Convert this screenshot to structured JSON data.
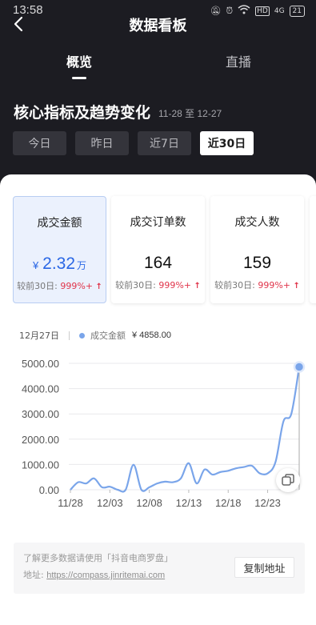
{
  "status_bar": {
    "time": "13:58",
    "icons": [
      "bell-off-icon",
      "alarm-icon",
      "wifi-icon",
      "hd-icon",
      "signal-icon",
      "battery-icon"
    ],
    "network": "4G",
    "battery": "21"
  },
  "nav": {
    "title": "数据看板"
  },
  "tabs": [
    {
      "label": "概览",
      "active": true
    },
    {
      "label": "直播",
      "active": false
    }
  ],
  "section": {
    "title": "核心指标及趋势变化",
    "range": "11-28 至 12-27"
  },
  "periods": [
    {
      "label": "今日",
      "active": false
    },
    {
      "label": "昨日",
      "active": false
    },
    {
      "label": "近7日",
      "active": false
    },
    {
      "label": "近30日",
      "active": true
    }
  ],
  "metrics": [
    {
      "label": "成交金额",
      "currency": "¥",
      "value": "2.32",
      "unit": "万",
      "compare_prefix": "较前30日: ",
      "compare_value": "999%+",
      "active": true
    },
    {
      "label": "成交订单数",
      "currency": "",
      "value": "164",
      "unit": "",
      "compare_prefix": "较前30日: ",
      "compare_value": "999%+",
      "active": false
    },
    {
      "label": "成交人数",
      "currency": "",
      "value": "159",
      "unit": "",
      "compare_prefix": "较前30日: ",
      "compare_value": "999%+",
      "active": false
    }
  ],
  "legend": {
    "date": "12月27日",
    "series_name": "成交金额",
    "series_value": "¥ 4858.00"
  },
  "chart_data": {
    "type": "line",
    "series": [
      {
        "name": "成交金额",
        "x": [
          "11/28",
          "11/29",
          "11/30",
          "12/01",
          "12/02",
          "12/03",
          "12/04",
          "12/05",
          "12/06",
          "12/07",
          "12/08",
          "12/09",
          "12/10",
          "12/11",
          "12/12",
          "12/13",
          "12/14",
          "12/15",
          "12/16",
          "12/17",
          "12/18",
          "12/19",
          "12/20",
          "12/21",
          "12/22",
          "12/23",
          "12/24",
          "12/25",
          "12/26",
          "12/27"
        ],
        "values": [
          0,
          300,
          250,
          450,
          100,
          120,
          0,
          0,
          990,
          0,
          100,
          250,
          320,
          300,
          450,
          1050,
          250,
          800,
          600,
          700,
          750,
          850,
          900,
          950,
          650,
          650,
          1100,
          2700,
          3000,
          4858
        ]
      }
    ],
    "x_tick_labels": [
      "11/28",
      "12/03",
      "12/08",
      "12/13",
      "12/18",
      "12/23"
    ],
    "y_tick_labels": [
      "0.00",
      "1000.00",
      "2000.00",
      "3000.00",
      "4000.00",
      "5000.00"
    ],
    "ylim": [
      0,
      5000
    ],
    "grid": true,
    "highlight_index": 29,
    "color": "#7aa5ea"
  },
  "footer": {
    "line1": "了解更多数据请使用「抖音电商罗盘」",
    "address_label": "地址: ",
    "address_url": "https://compass.jinritemai.com",
    "copy_button": "复制地址"
  }
}
